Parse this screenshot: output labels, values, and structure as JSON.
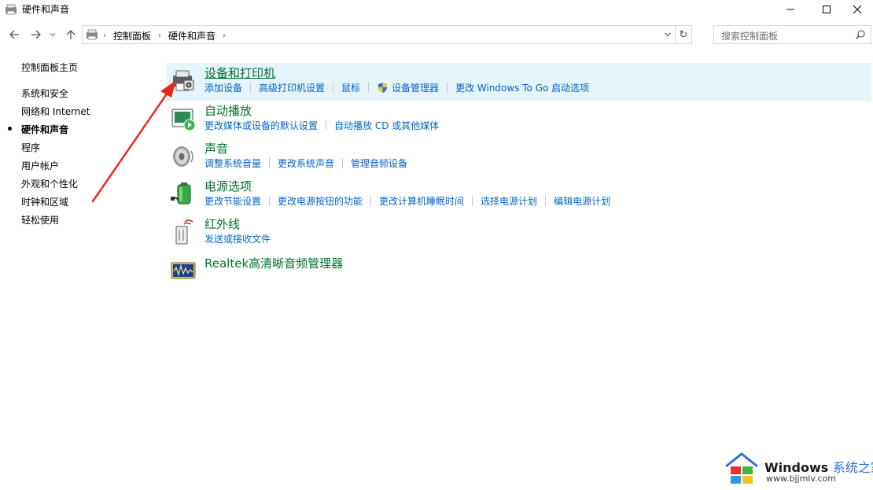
{
  "window": {
    "title": "硬件和声音",
    "buttons": {
      "minimize": "minimize",
      "maximize": "maximize",
      "close": "close"
    }
  },
  "nav": {
    "back_icon": "back-arrow-icon",
    "forward_icon": "forward-arrow-icon",
    "recent_icon": "chevron-down-icon",
    "up_icon": "up-arrow-icon"
  },
  "address": {
    "crumbs": [
      "控制面板",
      "硬件和声音"
    ],
    "refresh_glyph": "↻"
  },
  "search": {
    "placeholder": "搜索控制面板"
  },
  "sidebar": {
    "items": [
      {
        "label": "控制面板主页",
        "current": false
      },
      {
        "label": "系统和安全",
        "current": false
      },
      {
        "label": "网络和 Internet",
        "current": false
      },
      {
        "label": "硬件和声音",
        "current": true
      },
      {
        "label": "程序",
        "current": false
      },
      {
        "label": "用户帐户",
        "current": false
      },
      {
        "label": "外观和个性化",
        "current": false
      },
      {
        "label": "时钟和区域",
        "current": false
      },
      {
        "label": "轻松使用",
        "current": false
      }
    ]
  },
  "categories": [
    {
      "title": "设备和打印机",
      "icon": "printer-icon",
      "links": [
        "添加设备",
        "高级打印机设置",
        "鼠标",
        "设备管理器",
        "更改 Windows To Go 启动选项"
      ]
    },
    {
      "title": "自动播放",
      "icon": "autoplay-icon",
      "links": [
        "更改媒体或设备的默认设置",
        "自动播放 CD 或其他媒体"
      ]
    },
    {
      "title": "声音",
      "icon": "speaker-icon",
      "links": [
        "调整系统音量",
        "更改系统声音",
        "管理音频设备"
      ]
    },
    {
      "title": "电源选项",
      "icon": "battery-icon",
      "links": [
        "更改节能设置",
        "更改电源按钮的功能",
        "更改计算机睡眠时间",
        "选择电源计划",
        "编辑电源计划"
      ]
    },
    {
      "title": "红外线",
      "icon": "infrared-icon",
      "links": [
        "发送或接收文件"
      ]
    },
    {
      "title": "Realtek高清晰音频管理器",
      "icon": "realtek-audio-icon",
      "links": []
    }
  ],
  "colors": {
    "heading": "#00732f",
    "link": "#0066cc",
    "highlight": "#e5f3fb",
    "arrow": "#e8281e"
  },
  "watermark": {
    "brand": "Windows",
    "brand_cn": "系统之家",
    "url": "www.bjjmlv.com"
  }
}
